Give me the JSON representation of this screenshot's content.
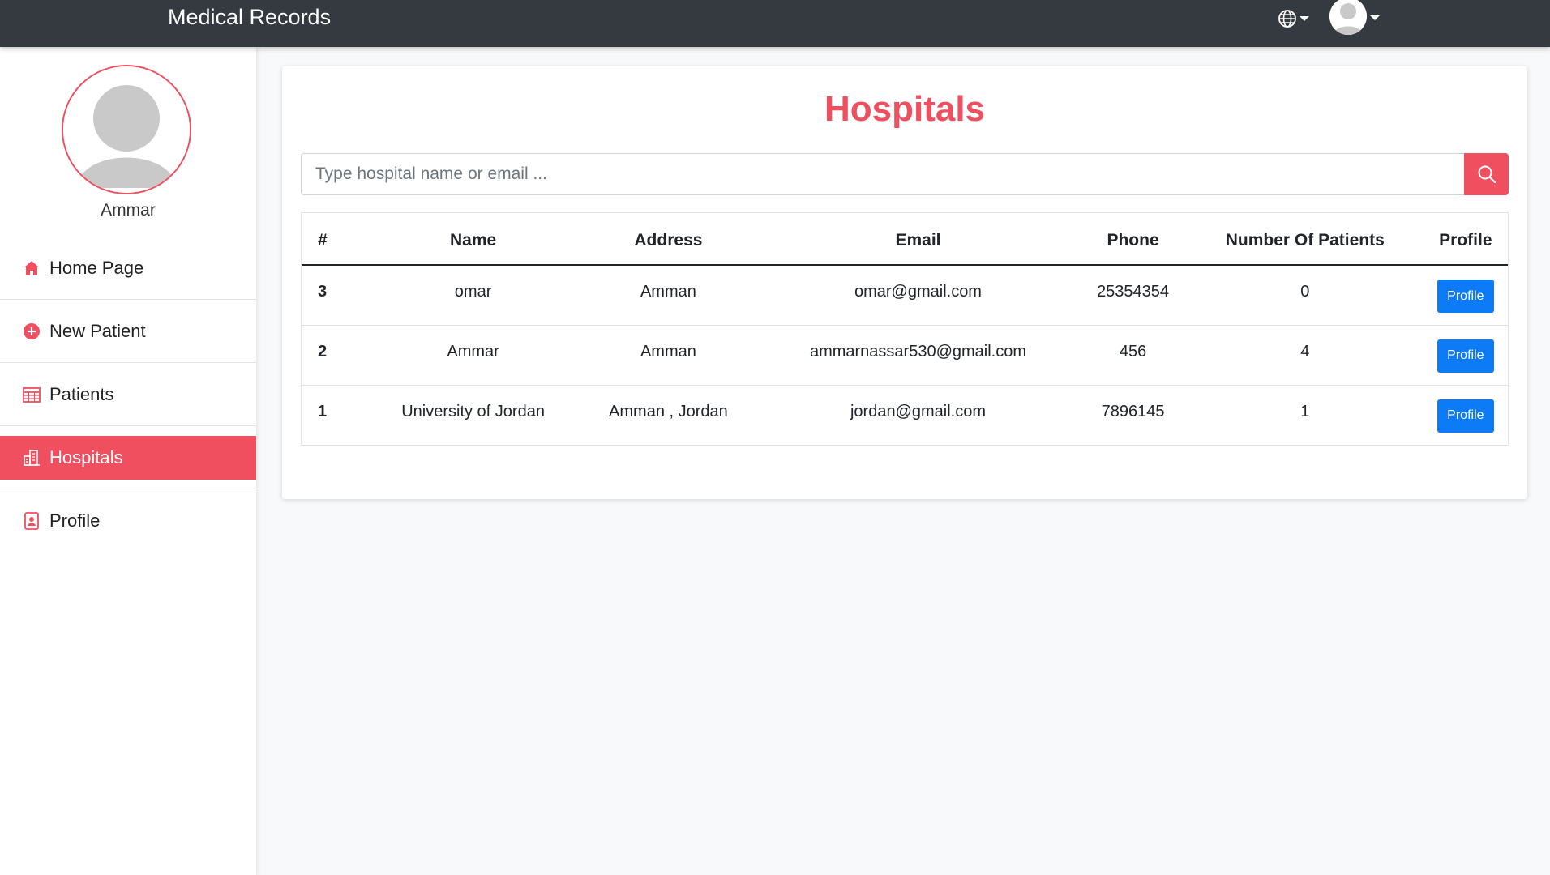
{
  "navbar": {
    "brand": "Medical Records"
  },
  "sidebar": {
    "user_name": "Ammar",
    "items": [
      {
        "label": "Home Page",
        "icon": "home-icon"
      },
      {
        "label": "New Patient",
        "icon": "plus-circle-icon"
      },
      {
        "label": "Patients",
        "icon": "table-icon"
      },
      {
        "label": "Hospitals",
        "icon": "hospital-icon",
        "active": true
      },
      {
        "label": "Profile",
        "icon": "profile-card-icon"
      }
    ]
  },
  "main": {
    "title": "Hospitals",
    "search": {
      "placeholder": "Type hospital name or email ..."
    },
    "table": {
      "headers": [
        "#",
        "Name",
        "Address",
        "Email",
        "Phone",
        "Number Of Patients",
        "Profile"
      ],
      "button_label": "Profile",
      "rows": [
        {
          "num": "3",
          "name": "omar",
          "address": "Amman",
          "email": "omar@gmail.com",
          "phone": "25354354",
          "patients": "0"
        },
        {
          "num": "2",
          "name": "Ammar",
          "address": "Amman",
          "email": "ammarnassar530@gmail.com",
          "phone": "456",
          "patients": "4"
        },
        {
          "num": "1",
          "name": "University of Jordan",
          "address": "Amman , Jordan",
          "email": "jordan@gmail.com",
          "phone": "7896145",
          "patients": "1"
        }
      ]
    }
  },
  "colors": {
    "accent": "#ef4f5f",
    "navbar": "#343a40",
    "primary_button": "#0d7bf5"
  }
}
